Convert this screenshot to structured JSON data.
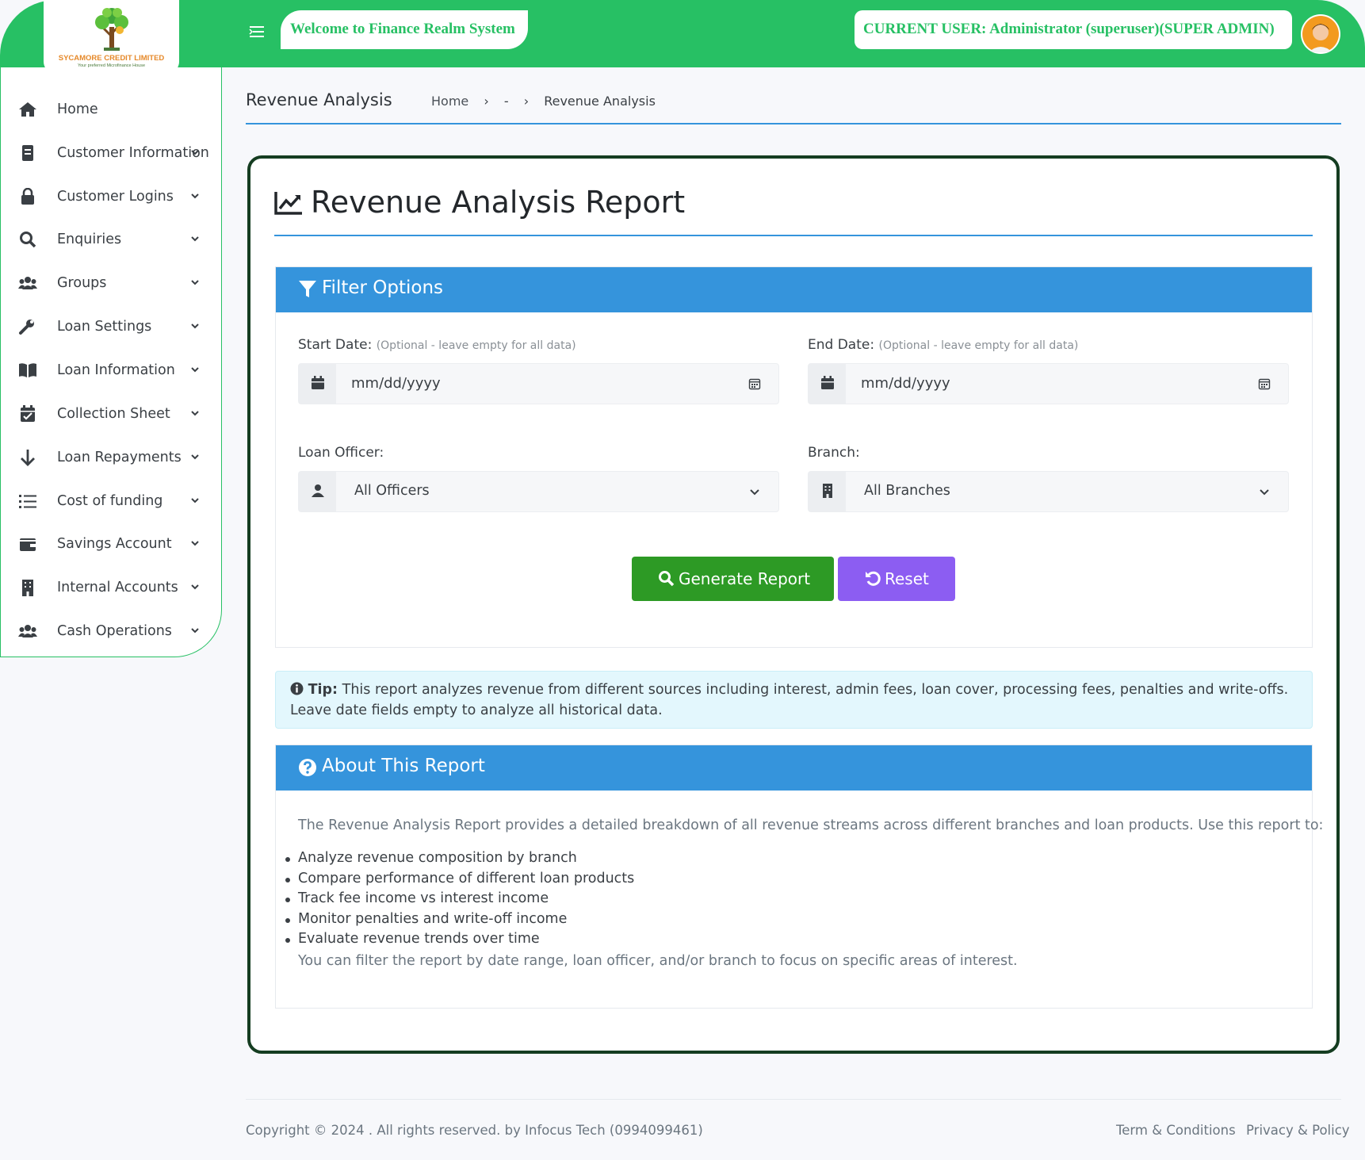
{
  "header": {
    "logo_name": "SYCAMORE CREDIT LIMITED",
    "logo_tagline": "Your preferred Microfinance House",
    "welcome": "Welcome to Finance Realm System",
    "current_user": "CURRENT USER: Administrator (superuser)(SUPER ADMIN)",
    "brand_color": "#27c064"
  },
  "sidebar": {
    "items": [
      {
        "label": "Home",
        "icon": "home-icon"
      },
      {
        "label": "Customer Information",
        "icon": "document-icon"
      },
      {
        "label": "Customer Logins",
        "icon": "lock-icon"
      },
      {
        "label": "Enquiries",
        "icon": "search-icon"
      },
      {
        "label": "Groups",
        "icon": "users-icon"
      },
      {
        "label": "Loan Settings",
        "icon": "wrench-icon"
      },
      {
        "label": "Loan Information",
        "icon": "book-icon"
      },
      {
        "label": "Collection Sheet",
        "icon": "calendar-check-icon"
      },
      {
        "label": "Loan Repayments",
        "icon": "arrow-down-icon"
      },
      {
        "label": "Cost of funding",
        "icon": "list-icon"
      },
      {
        "label": "Savings Account",
        "icon": "wallet-icon"
      },
      {
        "label": "Internal Accounts",
        "icon": "building-icon"
      },
      {
        "label": "Cash Operations",
        "icon": "users-icon"
      }
    ]
  },
  "breadcrumb": {
    "page_title": "Revenue Analysis",
    "home": "Home",
    "sep1": "›",
    "middle": "-",
    "sep2": "›",
    "current": "Revenue Analysis"
  },
  "report": {
    "title": "Revenue Analysis Report",
    "filter": {
      "heading": "Filter Options",
      "start_label": "Start Date:",
      "start_hint": "(Optional - leave empty for all data)",
      "start_placeholder": "mm/dd/yyyy",
      "end_label": "End Date:",
      "end_hint": "(Optional - leave empty for all data)",
      "end_placeholder": "mm/dd/yyyy",
      "officer_label": "Loan Officer:",
      "officer_value": "All Officers",
      "branch_label": "Branch:",
      "branch_value": "All Branches",
      "generate_label": "Generate Report",
      "reset_label": "Reset"
    },
    "tip": {
      "label": "Tip:",
      "text": "This report analyzes revenue from different sources including interest, admin fees, loan cover, processing fees, penalties and write-offs. Leave date fields empty to analyze all historical data."
    },
    "about": {
      "heading": "About This Report",
      "intro": "The Revenue Analysis Report provides a detailed breakdown of all revenue streams across different branches and loan products. Use this report to:",
      "items": [
        "Analyze revenue composition by branch",
        "Compare performance of different loan products",
        "Track fee income vs interest income",
        "Monitor penalties and write-off income",
        "Evaluate revenue trends over time"
      ],
      "outro": "You can filter the report by date range, loan officer, and/or branch to focus on specific areas of interest."
    }
  },
  "footer": {
    "copyright": "Copyright © 2024 . All rights reserved. by Infocus Tech (0994099461)",
    "terms": "Term & Conditions",
    "privacy": "Privacy & Policy"
  }
}
